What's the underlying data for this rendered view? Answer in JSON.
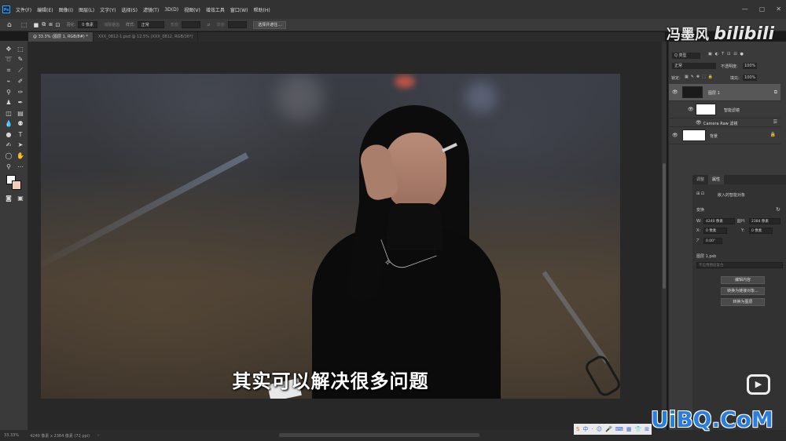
{
  "app": {
    "logo": "Ps"
  },
  "menu": [
    "文件(F)",
    "编辑(E)",
    "图像(I)",
    "图层(L)",
    "文字(Y)",
    "选择(S)",
    "滤镜(T)",
    "3D(D)",
    "视图(V)",
    "增效工具",
    "窗口(W)",
    "帮助(H)"
  ],
  "options": {
    "feather_label": "羽化:",
    "feather_value": "0 像素",
    "antialias_label": "消除锯齿",
    "style_label": "样式:",
    "style_value": "正常",
    "width_label": "宽度:",
    "height_label": "高度:",
    "select_mask_button": "选择并遮住..."
  },
  "tabs": [
    {
      "label": "@ 33.3% (图层 1, RGB/8#) *",
      "active": true
    },
    {
      "label": "XXX_0812-1.psd @ 12.5% (XXX_0812, RGB/16*)",
      "active": false
    }
  ],
  "canvas": {
    "subtitle": "其实可以解决很多问题"
  },
  "watermark": {
    "author": "冯墨风",
    "brand": "bilibili"
  },
  "layers_panel": {
    "filter_label": "Q 类型",
    "blend_mode": "正常",
    "opacity_label": "不透明度:",
    "opacity_value": "100%",
    "lock_label": "锁定:",
    "fill_label": "填充:",
    "fill_value": "100%",
    "layers": [
      {
        "name": "图层 1",
        "selected": true
      },
      {
        "name": "智能滤镜",
        "selected": false
      },
      {
        "name": "Camera Raw 滤镜",
        "selected": false
      },
      {
        "name": "背景",
        "selected": false
      }
    ]
  },
  "properties": {
    "tab_inactive": "调整",
    "tab_active": "属性",
    "object_type": "嵌入的智能对象",
    "transform_label": "变换",
    "w_label": "W:",
    "w_value": "4240 像素",
    "h_label": "H:",
    "h_value": "2384 像素",
    "x_label": "X:",
    "x_value": "0 像素",
    "y_label": "Y:",
    "y_value": "0 像素",
    "angle_value": "0.00°",
    "file_label": "图层 1.psb",
    "comps_placeholder": "不应用图层复合",
    "edit_contents_button": "编辑内容",
    "convert_linked_button": "转换为链接对象...",
    "convert_layers_button": "转换为图层"
  },
  "status": {
    "zoom": "33.33%",
    "doc_info": "4240 像素 x 2384 像素 (72 ppi)"
  },
  "tray": {
    "items": [
      "S",
      "中",
      "·",
      "☺",
      "🎤",
      "⌨",
      "▦",
      "👕",
      "⊞"
    ]
  },
  "site_watermark": "UiBQ.CoM"
}
